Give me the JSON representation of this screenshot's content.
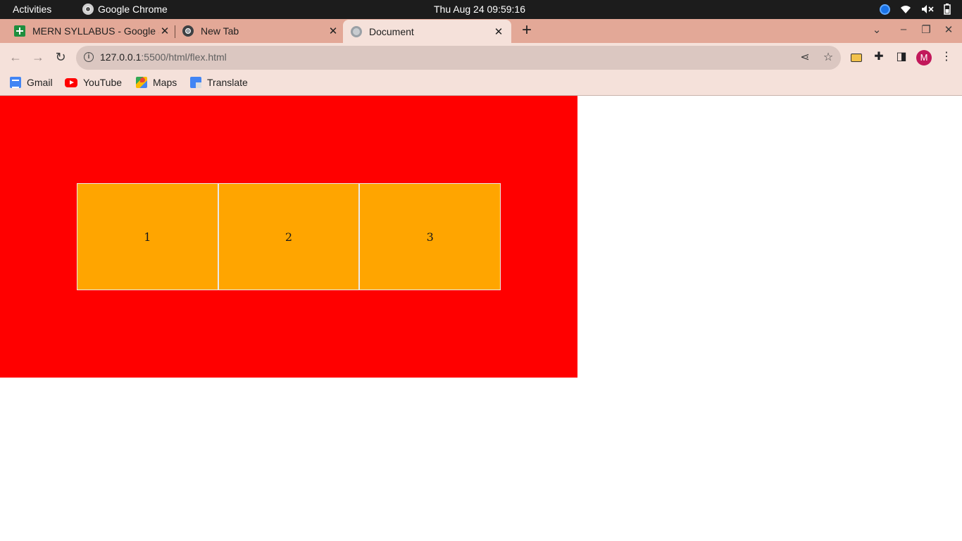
{
  "system_bar": {
    "activities": "Activities",
    "app_name": "Google Chrome",
    "clock": "Thu Aug 24  09:59:16"
  },
  "browser": {
    "tabs": [
      {
        "title": "MERN SYLLABUS - Google Sheets",
        "icon": "sheets-icon",
        "active": false
      },
      {
        "title": "New Tab",
        "icon": "chrome-icon",
        "active": false
      },
      {
        "title": "Document",
        "icon": "globe-icon",
        "active": true
      }
    ],
    "address": {
      "host": "127.0.0.1",
      "path": ":5500/html/flex.html"
    },
    "profile_initial": "M",
    "bookmarks": [
      {
        "label": "Gmail",
        "icon": "gmail-icon"
      },
      {
        "label": "YouTube",
        "icon": "youtube-icon"
      },
      {
        "label": "Maps",
        "icon": "maps-icon"
      },
      {
        "label": "Translate",
        "icon": "translate-icon"
      }
    ]
  },
  "page": {
    "container_color": "#ff0000",
    "box_color": "#ffa500",
    "boxes": [
      "1",
      "2",
      "3"
    ]
  }
}
